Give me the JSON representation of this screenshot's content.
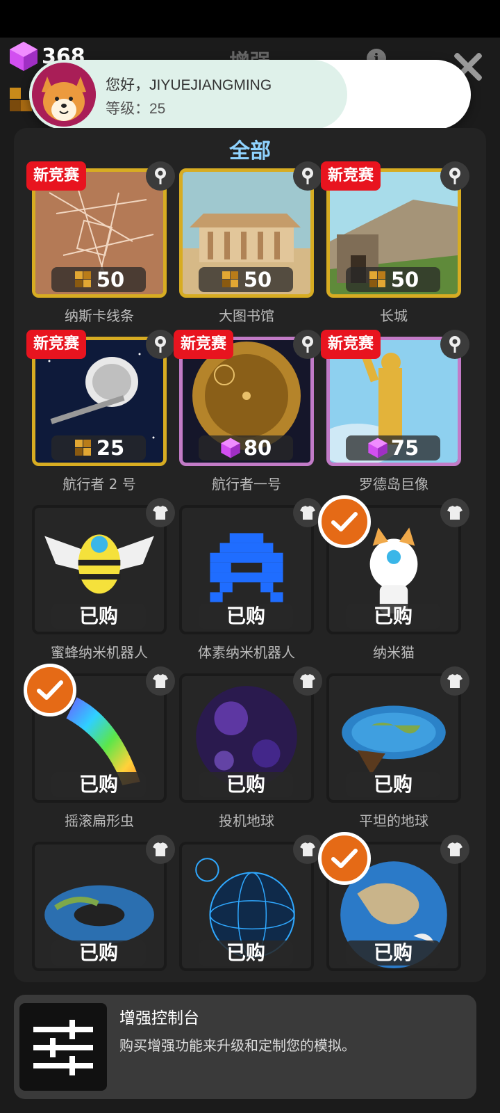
{
  "header": {
    "gem_count": "368",
    "title": "增强",
    "toast": {
      "greeting": "您好，JIYUEJIANGMING",
      "level": "等级：25"
    }
  },
  "panel": {
    "title": "全部",
    "items": [
      {
        "name": "纳斯卡线条",
        "badge": "新竞赛",
        "price": "50",
        "currency": "gold",
        "frame": "gold",
        "corner_icon": "pin-icon"
      },
      {
        "name": "大图书馆",
        "badge": "",
        "price": "50",
        "currency": "gold",
        "frame": "gold",
        "corner_icon": "pin-icon"
      },
      {
        "name": "长城",
        "badge": "新竞赛",
        "price": "50",
        "currency": "gold",
        "frame": "gold",
        "corner_icon": "pin-icon"
      },
      {
        "name": "航行者 2 号",
        "badge": "新竞赛",
        "price": "25",
        "currency": "gold",
        "frame": "gold",
        "corner_icon": "pin-icon"
      },
      {
        "name": "航行者一号",
        "badge": "新竞赛",
        "price": "80",
        "currency": "gem",
        "frame": "purple",
        "corner_icon": "pin-icon"
      },
      {
        "name": "罗德岛巨像",
        "badge": "新竞赛",
        "price": "75",
        "currency": "gem",
        "frame": "purple",
        "corner_icon": "pin-icon"
      },
      {
        "name": "蜜蜂纳米机器人",
        "owned": "已购",
        "checked": false,
        "corner_icon": "shirt-icon"
      },
      {
        "name": "体素纳米机器人",
        "owned": "已购",
        "checked": false,
        "corner_icon": "shirt-icon"
      },
      {
        "name": "纳米猫",
        "owned": "已购",
        "checked": true,
        "corner_icon": "shirt-icon"
      },
      {
        "name": "摇滚扁形虫",
        "owned": "已购",
        "checked": true,
        "corner_icon": "shirt-icon"
      },
      {
        "name": "投机地球",
        "owned": "已购",
        "checked": false,
        "corner_icon": "shirt-icon"
      },
      {
        "name": "平坦的地球",
        "owned": "已购",
        "checked": false,
        "corner_icon": "shirt-icon"
      },
      {
        "name": "",
        "owned": "已购",
        "checked": false,
        "corner_icon": "shirt-icon"
      },
      {
        "name": "",
        "owned": "已购",
        "checked": false,
        "corner_icon": "shirt-icon"
      },
      {
        "name": "",
        "owned": "已购",
        "checked": true,
        "corner_icon": "shirt-icon"
      }
    ]
  },
  "footer": {
    "title": "增强控制台",
    "description": "购买增强功能来升级和定制您的模拟。"
  },
  "colors": {
    "accent_blue": "#8fd3ff",
    "badge_red": "#e8141f",
    "gold_frame": "#d7ac22",
    "purple_frame": "#c27bc7",
    "check_orange": "#e56a16"
  }
}
